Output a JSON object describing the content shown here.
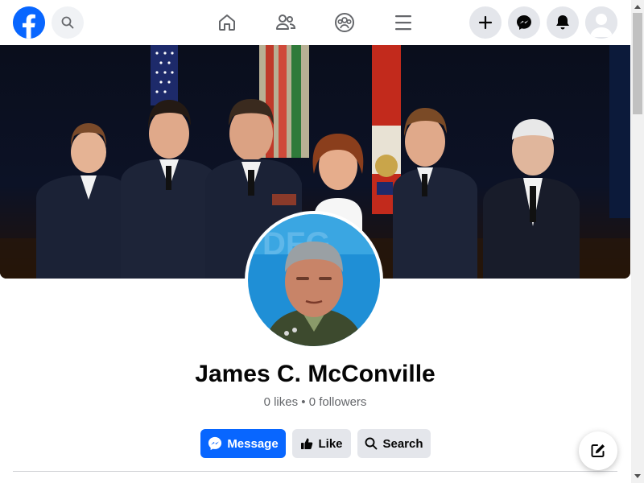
{
  "app": {
    "name": "Facebook"
  },
  "topbar": {
    "nav": [
      "home-icon",
      "friends-icon",
      "groups-icon",
      "menu-icon"
    ],
    "actions": [
      "plus-icon",
      "messenger-icon",
      "bell-icon",
      "avatar"
    ]
  },
  "profile": {
    "name": "James C. McConville",
    "likes": "0 likes",
    "separator": " • ",
    "followers": "0 followers"
  },
  "buttons": {
    "message_label": "Message",
    "like_label": "Like",
    "search_label": "Search"
  },
  "colors": {
    "brand": "#0866ff",
    "secondary_button": "#e4e6eb",
    "text_primary": "#050505",
    "text_secondary": "#65676b"
  }
}
